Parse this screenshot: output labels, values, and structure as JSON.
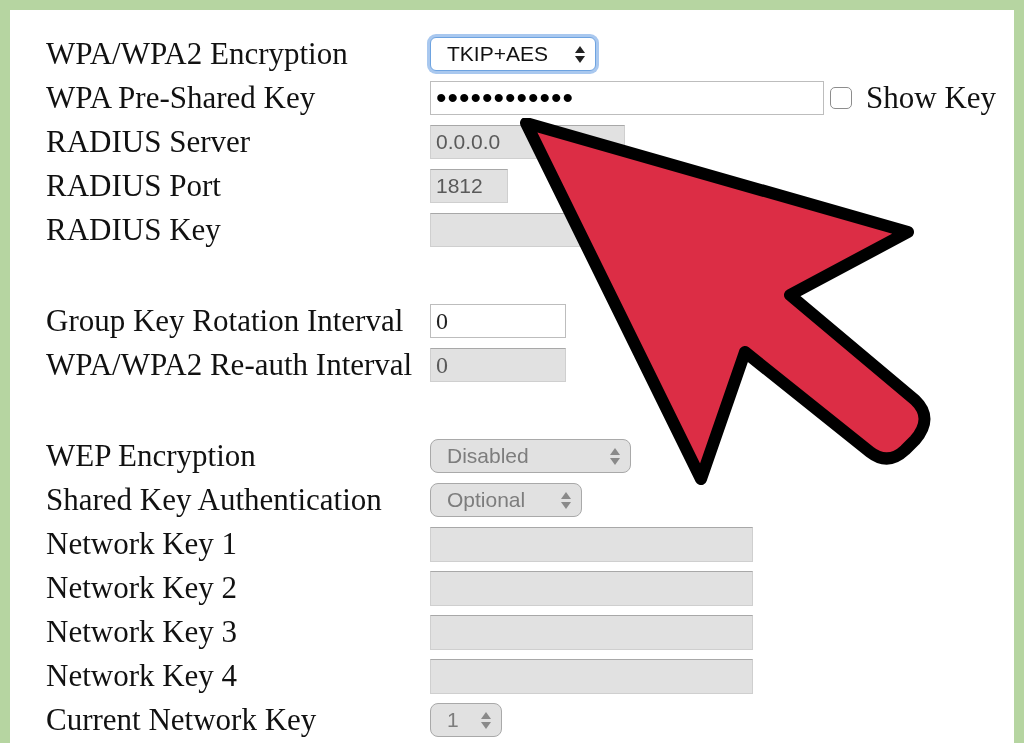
{
  "sections": [
    {
      "rows": [
        {
          "label": "WPA/WPA2 Encryption",
          "control": {
            "kind": "select",
            "value": "TKIP+AES",
            "disabled": false,
            "focused": true
          }
        },
        {
          "label": "WPA Pre-Shared Key",
          "control": {
            "kind": "password",
            "value": "••••••••••••",
            "disabled": false,
            "focused": false
          },
          "checkbox": {
            "label": "Show Key",
            "checked": false
          }
        },
        {
          "label": "RADIUS Server",
          "control": {
            "kind": "text",
            "value": "0.0.0.0",
            "disabled": true,
            "focused": false
          }
        },
        {
          "label": "RADIUS Port",
          "control": {
            "kind": "text",
            "value": "1812",
            "disabled": true,
            "focused": false
          }
        },
        {
          "label": "RADIUS Key",
          "control": {
            "kind": "text",
            "disabled": true,
            "focused": false
          }
        }
      ]
    },
    {
      "rows": [
        {
          "label": "Group Key Rotation Interval",
          "control": {
            "kind": "text",
            "value": "0",
            "disabled": false,
            "focused": false
          }
        },
        {
          "label": "WPA/WPA2 Re-auth Interval",
          "control": {
            "kind": "text",
            "value": "0",
            "disabled": true,
            "focused": false
          }
        }
      ]
    },
    {
      "rows": [
        {
          "label": "WEP Encryption",
          "control": {
            "kind": "select",
            "value": "Disabled",
            "disabled": true,
            "focused": false
          }
        },
        {
          "label": "Shared Key Authentication",
          "control": {
            "kind": "select",
            "value": "Optional",
            "disabled": true,
            "focused": false
          }
        },
        {
          "label": "Network Key 1",
          "control": {
            "kind": "text",
            "disabled": true,
            "focused": false
          }
        },
        {
          "label": "Network Key 2",
          "control": {
            "kind": "text",
            "disabled": true,
            "focused": false
          }
        },
        {
          "label": "Network Key 3",
          "control": {
            "kind": "text",
            "disabled": true,
            "focused": false
          }
        },
        {
          "label": "Network Key 4",
          "control": {
            "kind": "text",
            "disabled": true,
            "focused": false
          }
        },
        {
          "label": "Current Network Key",
          "control": {
            "kind": "select",
            "value": "1",
            "disabled": true,
            "focused": false
          }
        }
      ]
    }
  ]
}
